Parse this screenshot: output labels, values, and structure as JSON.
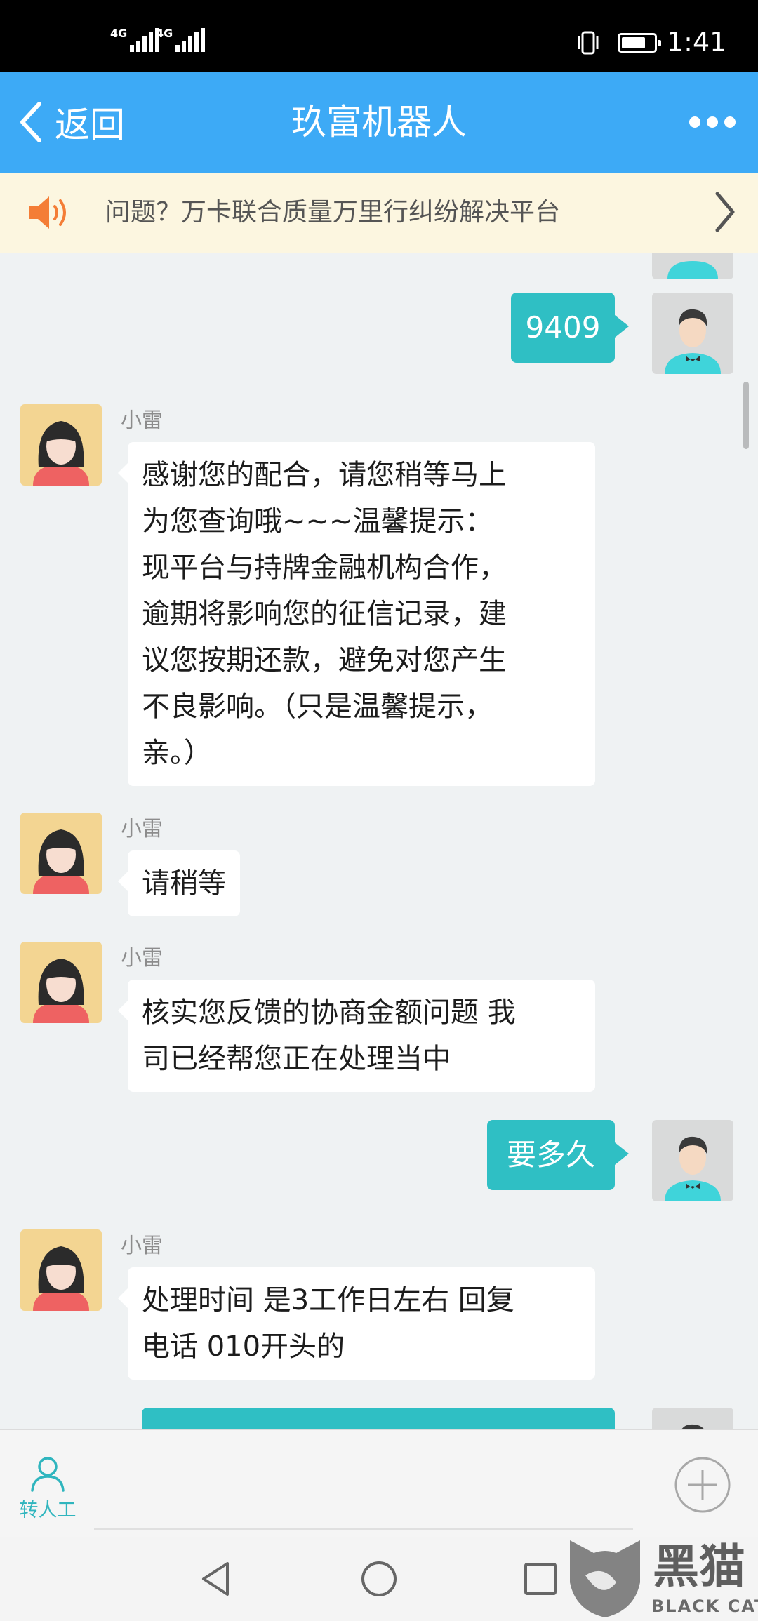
{
  "status": {
    "network_1": "4G",
    "network_2": "4G",
    "time": "1:41",
    "battery_level": 0.75
  },
  "header": {
    "back_label": "返回",
    "title": "玖富机器人"
  },
  "notice": {
    "text": "问题？万卡联合质量万里行纠纷解决平台"
  },
  "messages": [
    {
      "side": "right",
      "text": "9409"
    },
    {
      "side": "left",
      "sender": "小雷",
      "lines": [
        "感谢您的配合，请您稍等马上",
        "为您查询哦~~~温馨提示：",
        "现平台与持牌金融机构合作，",
        "逾期将影响您的征信记录，建",
        "议您按期还款，避免对您产生",
        "不良影响。（只是温馨提示，",
        "亲。）"
      ]
    },
    {
      "side": "left",
      "sender": "小雷",
      "lines": [
        "请稍等"
      ]
    },
    {
      "side": "left",
      "sender": "小雷",
      "lines": [
        "核实您反馈的协商金额问题 我",
        "司已经帮您正在处理当中"
      ]
    },
    {
      "side": "right",
      "text": "要多久"
    },
    {
      "side": "left",
      "sender": "小雷",
      "lines": [
        "处理时间 是3工作日左右 回复",
        "电话 010开头的"
      ]
    }
  ],
  "input_bar": {
    "transfer_label": "转人工"
  },
  "watermark": {
    "text": "黑猫",
    "subtext": "BLACK CAT"
  },
  "colors": {
    "title_bar": "#3daaf6",
    "user_bubble": "#2fbfc4",
    "notice_bg": "#fcf6e0",
    "chat_bg": "#eff2f3"
  }
}
